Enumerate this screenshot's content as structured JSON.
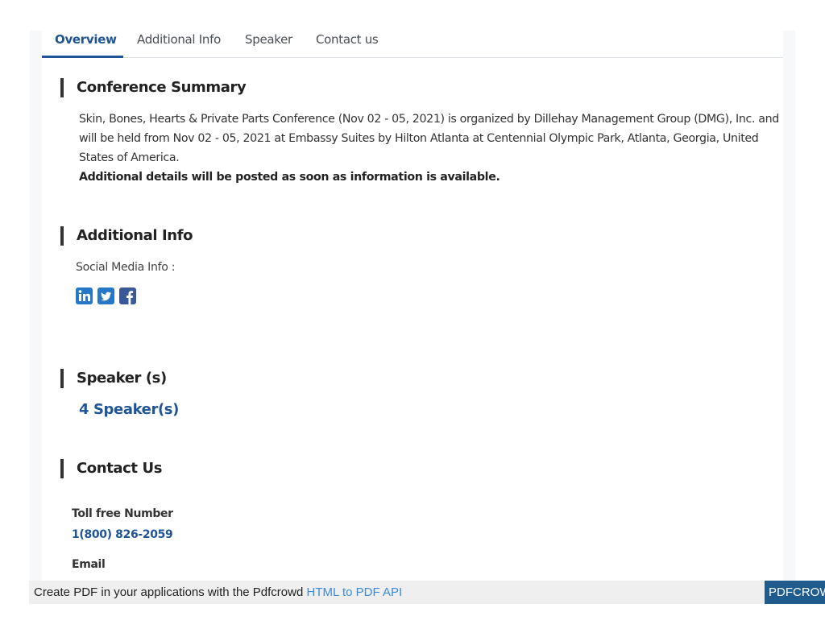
{
  "tabs": [
    {
      "label": "Overview",
      "active": true
    },
    {
      "label": "Additional Info",
      "active": false
    },
    {
      "label": "Speaker",
      "active": false
    },
    {
      "label": "Contact us",
      "active": false
    }
  ],
  "summary": {
    "heading": "Conference Summary",
    "text": "Skin, Bones, Hearts & Private Parts Conference (Nov 02 - 05, 2021) is organized by Dillehay Management Group (DMG), Inc. and will be held from Nov 02 - 05, 2021 at Embassy Suites by Hilton Atlanta at Centennial Olympic Park, Atlanta, Georgia, United States of America.",
    "note": "Additional details will be posted as soon as information is available."
  },
  "additional_info": {
    "heading": "Additional Info",
    "social_label": "Social Media Info :",
    "icons": [
      "linkedin-icon",
      "twitter-icon",
      "facebook-icon"
    ]
  },
  "speakers": {
    "heading": "Speaker (s)",
    "link": "4 Speaker(s)"
  },
  "contact": {
    "heading": "Contact Us",
    "toll_free_label": "Toll free Number",
    "toll_free_value": "1(800) 826-2059",
    "email_label": "Email"
  },
  "footer": {
    "text": "Create PDF in your applications with the Pdfcrowd",
    "link": "HTML to PDF API",
    "brand": "PDFCROWD"
  },
  "colors": {
    "accent": "#1f5597",
    "link_blue": "#3d8bd1",
    "linkedin": "#2777c7",
    "twitter": "#2777c7",
    "facebook": "#3b5998",
    "footer_brand_bg": "#1f5b8c"
  }
}
